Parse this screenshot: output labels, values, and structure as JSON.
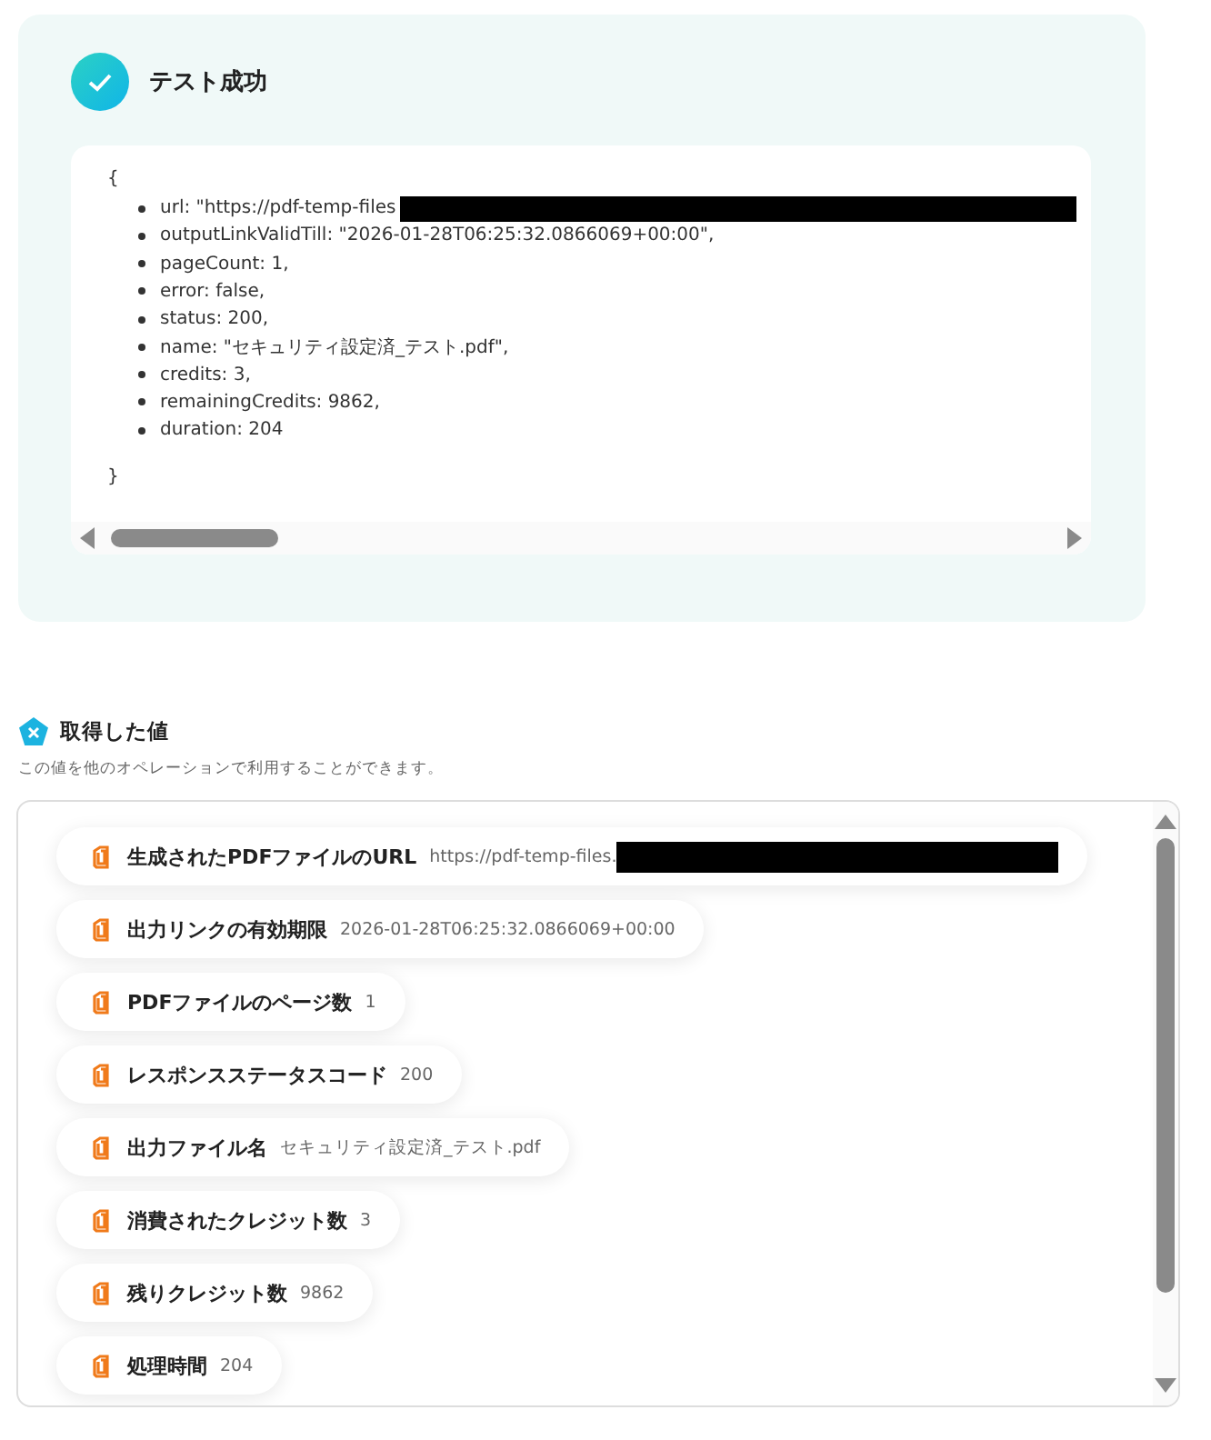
{
  "result": {
    "title": "テスト成功",
    "code": {
      "open": "{",
      "close": "}",
      "lines": [
        {
          "text": "url: \"https://pdf-temp-files",
          "redacted": true
        },
        {
          "text": "outputLinkValidTill: \"2026-01-28T06:25:32.0866069+00:00\",",
          "redacted": false
        },
        {
          "text": "pageCount: 1,",
          "redacted": false
        },
        {
          "text": "error: false,",
          "redacted": false
        },
        {
          "text": "status: 200,",
          "redacted": false
        },
        {
          "text": "name: \"セキュリティ設定済_テスト.pdf\",",
          "redacted": false
        },
        {
          "text": "credits: 3,",
          "redacted": false
        },
        {
          "text": "remainingCredits: 9862,",
          "redacted": false
        },
        {
          "text": "duration: 204",
          "redacted": false
        }
      ]
    }
  },
  "values": {
    "title": "取得した値",
    "description": "この値を他のオペレーションで利用することができます。",
    "items": [
      {
        "label": "生成されたPDFファイルのURL",
        "value": "https://pdf-temp-files.",
        "redacted": true
      },
      {
        "label": "出力リンクの有効期限",
        "value": "2026-01-28T06:25:32.0866069+00:00",
        "redacted": false
      },
      {
        "label": "PDFファイルのページ数",
        "value": "1",
        "redacted": false
      },
      {
        "label": "レスポンスステータスコード",
        "value": "200",
        "redacted": false
      },
      {
        "label": "出力ファイル名",
        "value": "セキュリティ設定済_テスト.pdf",
        "redacted": false
      },
      {
        "label": "消費されたクレジット数",
        "value": "3",
        "redacted": false
      },
      {
        "label": "残りクレジット数",
        "value": "9862",
        "redacted": false
      },
      {
        "label": "処理時間",
        "value": "204",
        "redacted": false
      }
    ]
  }
}
